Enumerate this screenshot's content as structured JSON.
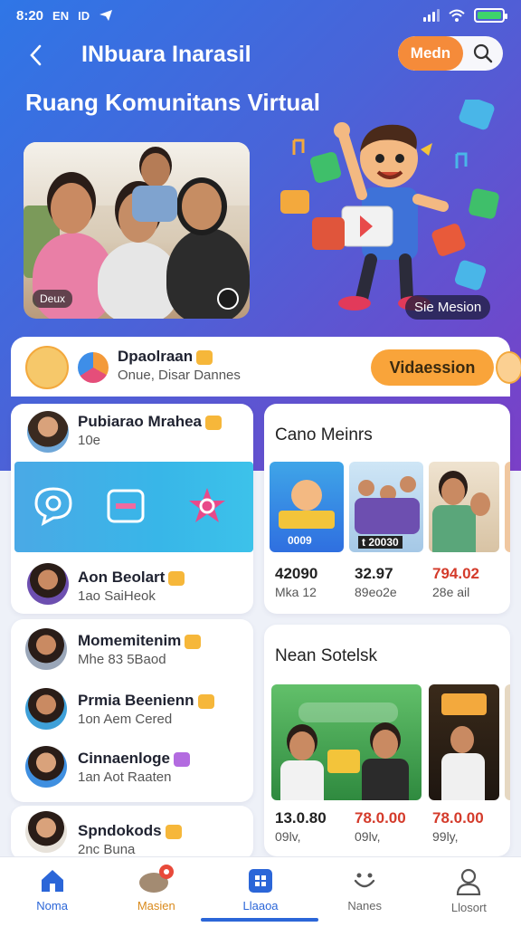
{
  "status_bar": {
    "time": "8:20",
    "icons_left": [
      "EN",
      "ID",
      "send-icon"
    ],
    "battery_percent": 100
  },
  "app_bar": {
    "title": "INbuara Inarasil",
    "media_label": "Medn"
  },
  "page_heading": "Ruang Komunitans Virtual",
  "hero": {
    "photo_badge": "Deux",
    "illustration_caption": "Sie Mesion"
  },
  "featured": {
    "title": "Dpaolraan",
    "subtitle": "Onue, Disar Dannes",
    "cta_label": "Vidaession"
  },
  "left_card_1": {
    "user_top": {
      "name": "Pubiarao Mrahea",
      "meta": "10e"
    },
    "user_bottom": {
      "name": "Aon Beolart",
      "meta": "1ao SaiHeok"
    }
  },
  "left_card_2": {
    "users": [
      {
        "name": "Momemitenim",
        "meta": "Mhe 83 5Baod"
      },
      {
        "name": "Prmia Beenienn",
        "meta": "1on Aem Cered"
      },
      {
        "name": "Cinnaenloge",
        "meta": "1an Aot Raaten"
      }
    ]
  },
  "left_card_3": {
    "user": {
      "name": "Spndokods",
      "meta": "2nc Buna"
    }
  },
  "section_1": {
    "title": "Cano Meinrs",
    "items": [
      {
        "stat": "42090",
        "sub": "Mka 12",
        "thumb_tag": "0009"
      },
      {
        "stat": "32.97",
        "sub": "89eo2e",
        "thumb_tag": "t 20030"
      },
      {
        "stat": "794.02",
        "sub": "28e ail"
      }
    ]
  },
  "section_2": {
    "title": "Nean Sotelsk",
    "items": [
      {
        "stat": "13.0.80",
        "sub": "09lv,"
      },
      {
        "stat": "78.0.00",
        "sub": "09lv,"
      },
      {
        "stat": "78.0.00",
        "sub": "99ly,"
      }
    ]
  },
  "bottom_nav": [
    {
      "label": "Noma",
      "icon": "home-icon"
    },
    {
      "label": "Masien",
      "icon": "pet-icon"
    },
    {
      "label": "Llaaoa",
      "icon": "grid-icon"
    },
    {
      "label": "Nanes",
      "icon": "smile-icon"
    },
    {
      "label": "Llosort",
      "icon": "person-icon"
    }
  ],
  "colors": {
    "accent_orange": "#f58b3a",
    "primary_blue": "#2b66d8",
    "hero_gradient_start": "#2f76e6",
    "hero_gradient_end": "#7b3fc7"
  }
}
